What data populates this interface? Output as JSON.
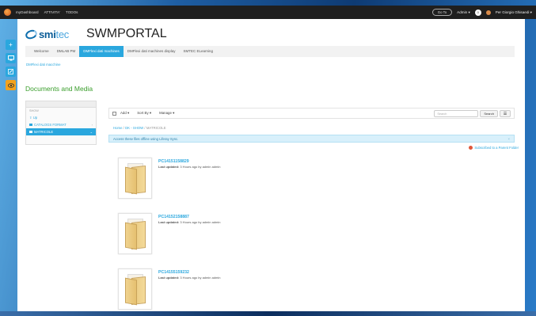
{
  "dockbar": {
    "title": "myDashboard",
    "items": [
      "ATTIVITA'",
      "TODOs"
    ],
    "goto": "Go To",
    "admin": "Admin ▾",
    "notifications": "0",
    "user": "Per Giorgio Ghisaedi ▾"
  },
  "header": {
    "brand_smi": "smi",
    "brand_tec": "tec",
    "site_title": "SWMPORTAL"
  },
  "nav": {
    "tabs": [
      "Welcome",
      "DMLAB PM",
      "DMFlexi dati machines",
      "DMFlexi dati machines display",
      "SMTEC ELearning"
    ]
  },
  "breadcrumb_top": "DMFlexi dati macchine",
  "portlet_title": "Documents and Media",
  "tree": {
    "heading": "SHOW",
    "items": [
      {
        "label": "Up",
        "active": false
      },
      {
        "label": "CATALOGS FORMAT",
        "active": false
      },
      {
        "label": "MATRICOLE",
        "active": true
      }
    ]
  },
  "toolbar": {
    "add": "Add ▾",
    "sort": "Sort By ▾",
    "manage": "Manage ▾",
    "search_placeholder": "Search",
    "search_button": "Search"
  },
  "path": {
    "home": "Home",
    "sep1": " / ",
    "dk": "DK - SHOW",
    "sep2": " / ",
    "current": "MATRICOLE"
  },
  "alert": {
    "text": "Access these files offline using Liferay Sync.",
    "close": "×"
  },
  "subscribe": "Subscribed to a Parent Folder",
  "entries": [
    {
      "title": "PC14151158829",
      "meta_label": "Last updated:",
      "meta_value": " 3 Hours ago by admin admin"
    },
    {
      "title": "PC14152158887",
      "meta_label": "Last updated:",
      "meta_value": " 3 Hours ago by admin admin"
    },
    {
      "title": "PC14155159232",
      "meta_label": "Last updated:",
      "meta_value": " 3 Hours ago by admin admin"
    }
  ]
}
